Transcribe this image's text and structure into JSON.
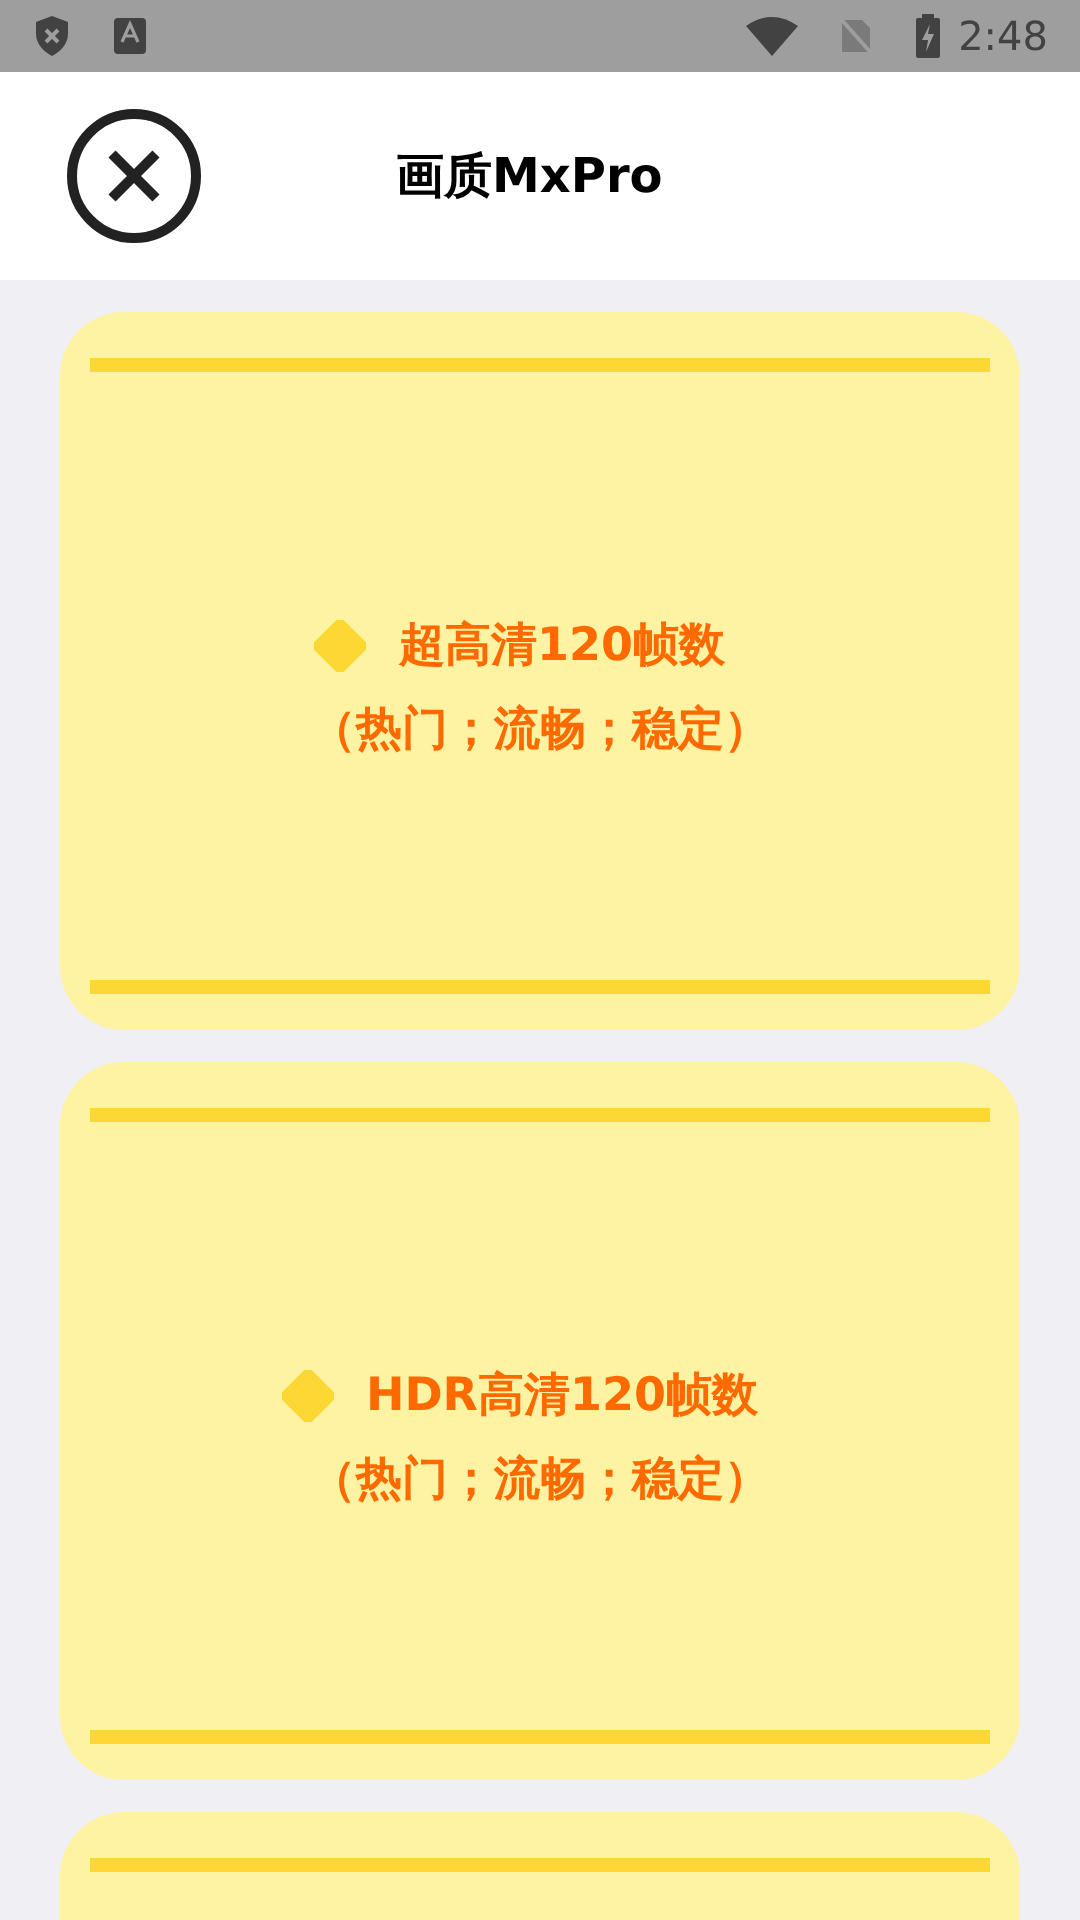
{
  "status_bar": {
    "time": "2:48"
  },
  "header": {
    "title": "画质MxPro"
  },
  "cards": [
    {
      "title": "超高清120帧数",
      "subtitle": "（热门；流畅；稳定）"
    },
    {
      "title": "HDR高清120帧数",
      "subtitle": "（热门；流畅；稳定）"
    }
  ],
  "more_cards_below": true
}
